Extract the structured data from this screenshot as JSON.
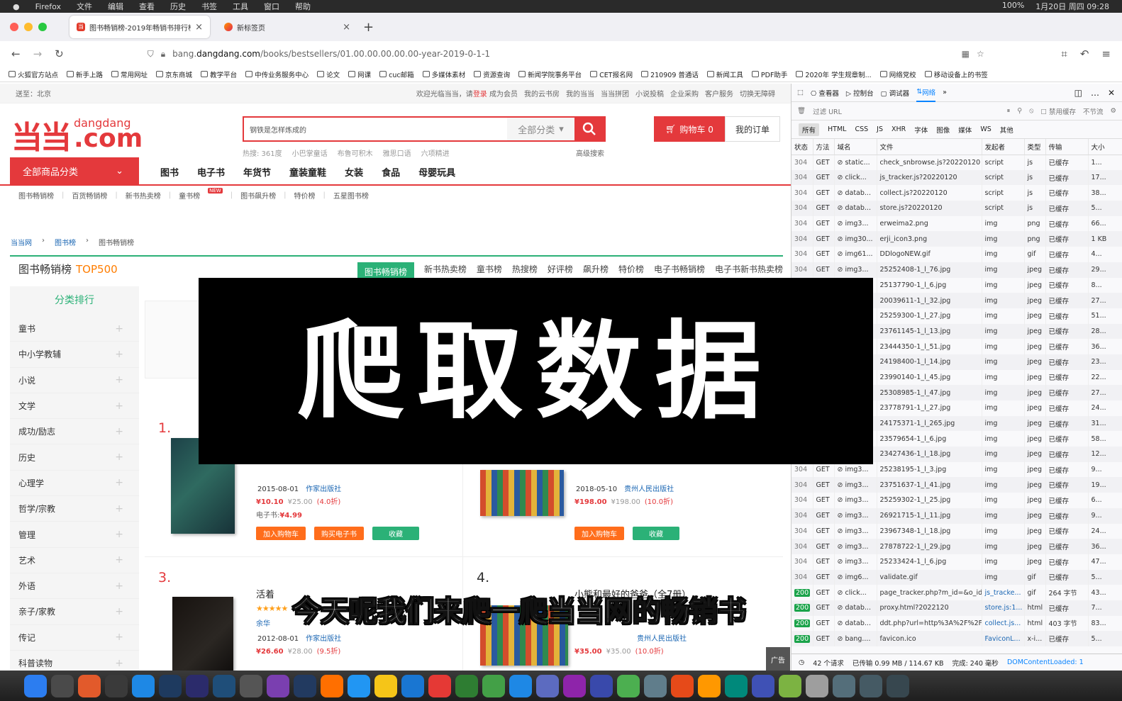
{
  "menubar": {
    "items": [
      "Firefox",
      "文件",
      "编辑",
      "查看",
      "历史",
      "书签",
      "工具",
      "窗口",
      "帮助"
    ],
    "status": [
      "100%",
      "1月20日 周四 09:28"
    ]
  },
  "tabs": [
    {
      "title": "图书畅销榜-2019年畅销书排行榜",
      "close": "×"
    },
    {
      "title": "新标签页",
      "close": "×"
    }
  ],
  "new_tab": "+",
  "url": {
    "prefix": "bang.",
    "domain": "dangdang.com",
    "path": "/books/bestsellers/01.00.00.00.00.00-year-2019-0-1-1"
  },
  "bookmarks": [
    "火狐官方站点",
    "新手上路",
    "常用网址",
    "京东商城",
    "教学平台",
    "中传业务服务中心",
    "论文",
    "网课",
    "cuc邮箱",
    "多媒体素材",
    "资源查询",
    "新闻学院事务平台",
    "CET报名网",
    "210909 普通话",
    "新闻工具",
    "PDF助手",
    "2020年 学生规章制...",
    "网络党校",
    "移动设备上的书签"
  ],
  "site": {
    "delivery": "送至：北京",
    "welcome": "欢迎光临当当，请",
    "login": "登录",
    "register": "成为会员",
    "top_links": [
      "我的云书房",
      "我的当当",
      "当当拼团",
      "小说投稿",
      "企业采购",
      "客户服务",
      "切换无障碍"
    ],
    "logo_cn": "当当",
    "logo_en_small": "dangdang",
    "logo_en_big": ".com",
    "search_value": "钢铁是怎样炼成的",
    "search_category": "全部分类",
    "hot_words": [
      "热搜: 361度",
      "小巴掌童话",
      "布鲁可积木",
      "雅思口语",
      "六项精进"
    ],
    "advanced_search": "高级搜索",
    "cart": "购物车 0",
    "orders": "我的订单",
    "all_categories": "全部商品分类",
    "main_nav": [
      "图书",
      "电子书",
      "年货节",
      "童装童鞋",
      "女装",
      "食品",
      "母婴玩具"
    ],
    "sub_nav": [
      "图书畅销榜",
      "百货畅销榜",
      "新书热卖榜",
      "童书榜",
      "图书飙升榜",
      "特价榜",
      "五星图书榜"
    ],
    "sub_nav_new": "NEW",
    "breadcrumb": [
      "当当网",
      "图书榜",
      "图书畅销榜"
    ],
    "rank_title": "图书畅销榜",
    "rank_top": "TOP500",
    "rank_tabs": [
      "图书畅销榜",
      "新书热卖榜",
      "童书榜",
      "热搜榜",
      "好评榜",
      "飙升榜",
      "特价榜",
      "电子书畅销榜",
      "电子书新书热卖榜"
    ],
    "sidebar_title": "分类排行",
    "sidebar": [
      "童书",
      "中小学教辅",
      "小说",
      "文学",
      "成功/励志",
      "历史",
      "心理学",
      "哲学/宗教",
      "管理",
      "艺术",
      "外语",
      "亲子/家教",
      "传记",
      "科普读物"
    ],
    "books": [
      {
        "rank": "1.",
        "date": "2015-08-01",
        "publisher": "作家出版社",
        "price": "¥10.10",
        "orig": "¥25.00",
        "discount": "(4.0折)",
        "ebook_label": "电子书:",
        "ebook_price": "¥4.99",
        "btn_cart": "加入购物车",
        "btn_ebook": "购买电子书",
        "btn_fav": "收藏"
      },
      {
        "rank": "",
        "date": "2018-05-10",
        "publisher": "贵州人民出版社",
        "price": "¥198.00",
        "orig": "¥198.00",
        "discount": "(10.0折)",
        "btn_cart": "加入购物车",
        "btn_fav": "收藏"
      },
      {
        "rank": "3.",
        "title": "活着",
        "stars": "★★★★★",
        "author": "余华",
        "date": "2012-08-01",
        "publisher": "作家出版社",
        "price": "¥26.60",
        "orig": "¥28.00",
        "discount": "(9.5折)"
      },
      {
        "rank": "4.",
        "title": "小熊和最好的爸爸（全7册）",
        "publisher": "贵州人民出版社",
        "price": "¥35.00",
        "orig": "¥35.00",
        "discount": "(10.0折)"
      }
    ]
  },
  "devtools": {
    "tabs": [
      "查看器",
      "控制台",
      "调试器",
      "网络"
    ],
    "filter_placeholder": "过滤 URL",
    "disable_cache": "禁用缓存",
    "throttle": "不节流",
    "type_filters": [
      "所有",
      "HTML",
      "CSS",
      "JS",
      "XHR",
      "字体",
      "图像",
      "媒体",
      "WS",
      "其他"
    ],
    "columns": [
      "状态",
      "方法",
      "域名",
      "文件",
      "发起者",
      "类型",
      "传输",
      "大小"
    ],
    "requests": [
      [
        "304",
        "GET",
        "static...",
        "check_snbrowse.js?20220120",
        "script",
        "js",
        "已缓存",
        "1..."
      ],
      [
        "304",
        "GET",
        "click...",
        "js_tracker.js?20220120",
        "script",
        "js",
        "已缓存",
        "17..."
      ],
      [
        "304",
        "GET",
        "datab...",
        "collect.js?20220120",
        "script",
        "js",
        "已缓存",
        "38..."
      ],
      [
        "304",
        "GET",
        "datab...",
        "store.js?20220120",
        "script",
        "js",
        "已缓存",
        "5..."
      ],
      [
        "304",
        "GET",
        "img3...",
        "erweima2.png",
        "img",
        "png",
        "已缓存",
        "66..."
      ],
      [
        "304",
        "GET",
        "img30...",
        "erji_icon3.png",
        "img",
        "png",
        "已缓存",
        "1 KB"
      ],
      [
        "304",
        "GET",
        "img61...",
        "DDlogoNEW.gif",
        "img",
        "gif",
        "已缓存",
        "4..."
      ],
      [
        "304",
        "GET",
        "img3...",
        "25252408-1_l_76.jpg",
        "img",
        "jpeg",
        "已缓存",
        "29..."
      ],
      [
        "304",
        "GET",
        "img3...",
        "25137790-1_l_6.jpg",
        "img",
        "jpeg",
        "已缓存",
        "8..."
      ],
      [
        "304",
        "GET",
        "img3...",
        "20039611-1_l_32.jpg",
        "img",
        "jpeg",
        "已缓存",
        "27..."
      ],
      [
        "304",
        "GET",
        "img3...",
        "25259300-1_l_27.jpg",
        "img",
        "jpeg",
        "已缓存",
        "51..."
      ],
      [
        "304",
        "GET",
        "img3...",
        "23761145-1_l_13.jpg",
        "img",
        "jpeg",
        "已缓存",
        "28..."
      ],
      [
        "304",
        "GET",
        "img3...",
        "23444350-1_l_51.jpg",
        "img",
        "jpeg",
        "已缓存",
        "36..."
      ],
      [
        "304",
        "GET",
        "img3...",
        "24198400-1_l_14.jpg",
        "img",
        "jpeg",
        "已缓存",
        "23..."
      ],
      [
        "304",
        "GET",
        "img3...",
        "23990140-1_l_45.jpg",
        "img",
        "jpeg",
        "已缓存",
        "22..."
      ],
      [
        "304",
        "GET",
        "img3...",
        "25308985-1_l_47.jpg",
        "img",
        "jpeg",
        "已缓存",
        "27..."
      ],
      [
        "304",
        "GET",
        "img3...",
        "23778791-1_l_27.jpg",
        "img",
        "jpeg",
        "已缓存",
        "24..."
      ],
      [
        "304",
        "GET",
        "img3...",
        "24175371-1_l_265.jpg",
        "img",
        "jpeg",
        "已缓存",
        "31..."
      ],
      [
        "304",
        "GET",
        "img3...",
        "23579654-1_l_6.jpg",
        "img",
        "jpeg",
        "已缓存",
        "58..."
      ],
      [
        "304",
        "GET",
        "img3...",
        "23427436-1_l_18.jpg",
        "img",
        "jpeg",
        "已缓存",
        "12..."
      ],
      [
        "304",
        "GET",
        "img3...",
        "25238195-1_l_3.jpg",
        "img",
        "jpeg",
        "已缓存",
        "9..."
      ],
      [
        "304",
        "GET",
        "img3...",
        "23751637-1_l_41.jpg",
        "img",
        "jpeg",
        "已缓存",
        "19..."
      ],
      [
        "304",
        "GET",
        "img3...",
        "25259302-1_l_25.jpg",
        "img",
        "jpeg",
        "已缓存",
        "6..."
      ],
      [
        "304",
        "GET",
        "img3...",
        "26921715-1_l_11.jpg",
        "img",
        "jpeg",
        "已缓存",
        "9..."
      ],
      [
        "304",
        "GET",
        "img3...",
        "23967348-1_l_18.jpg",
        "img",
        "jpeg",
        "已缓存",
        "24..."
      ],
      [
        "304",
        "GET",
        "img3...",
        "27878722-1_l_29.jpg",
        "img",
        "jpeg",
        "已缓存",
        "36..."
      ],
      [
        "304",
        "GET",
        "img3...",
        "25233424-1_l_6.jpg",
        "img",
        "jpeg",
        "已缓存",
        "47..."
      ],
      [
        "304",
        "GET",
        "img6...",
        "validate.gif",
        "img",
        "gif",
        "已缓存",
        "5..."
      ],
      [
        "200",
        "GET",
        "click...",
        "page_tracker.php?m_id=&o_id",
        "js_tracke...",
        "gif",
        "264 字节",
        "43..."
      ],
      [
        "200",
        "GET",
        "datab...",
        "proxy.html?2022120",
        "store.js:1...",
        "html",
        "已缓存",
        "7..."
      ],
      [
        "200",
        "GET",
        "datab...",
        "ddt.php?url=http%3A%2F%2F",
        "collect.js...",
        "html",
        "403 字节",
        "83..."
      ],
      [
        "200",
        "GET",
        "bang....",
        "favicon.ico",
        "FaviconL...",
        "x-i...",
        "已缓存",
        "5..."
      ]
    ],
    "footer": {
      "requests": "42 个请求",
      "transferred": "已传输 0.99 MB / 114.67 KB",
      "finished": "完成: 240 毫秒",
      "dcl": "DOMContentLoaded: 1"
    }
  },
  "overlay_title": "爬取数据",
  "subtitle": "今天呢我们来爬一爬当当网的畅销书",
  "ad_label": "广告",
  "colors": {
    "accent": "#e4393c",
    "green": "#2bb177",
    "devtools_blue": "#0a84ff"
  }
}
